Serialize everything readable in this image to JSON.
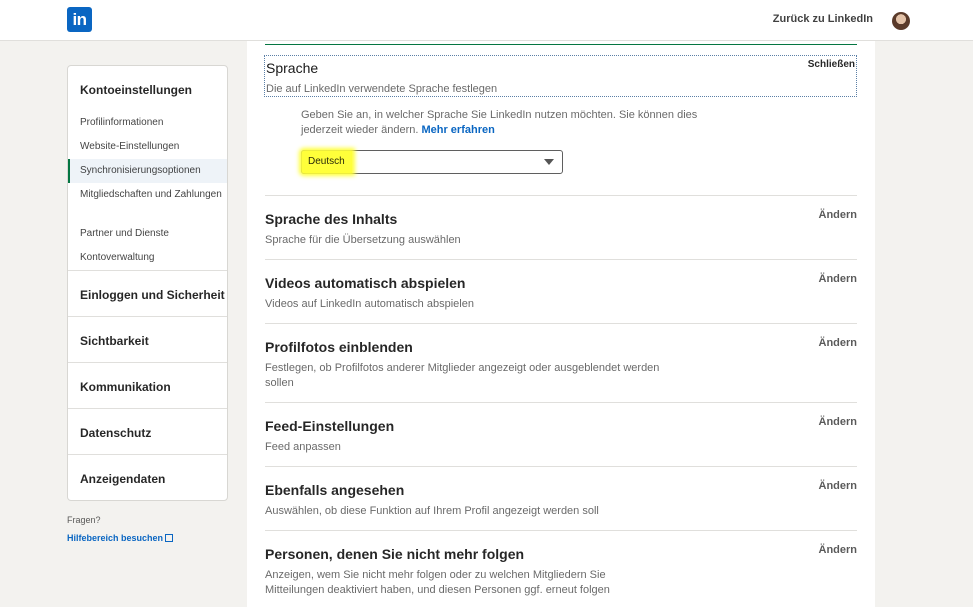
{
  "header": {
    "logo_text": "in",
    "back_link": "Zurück zu LinkedIn"
  },
  "sidebar": {
    "heading": "Kontoeinstellungen",
    "subitems": [
      {
        "label": "Profilinformationen"
      },
      {
        "label": "Website-Einstellungen"
      },
      {
        "label": "Synchronisierungsoptionen",
        "active": true
      },
      {
        "label": "Mitgliedschaften und Zahlungen"
      },
      {
        "label": "Partner und Dienste"
      },
      {
        "label": "Kontoverwaltung"
      }
    ],
    "categories": [
      {
        "label": "Einloggen und Sicherheit"
      },
      {
        "label": "Sichtbarkeit"
      },
      {
        "label": "Kommunikation"
      },
      {
        "label": "Datenschutz"
      },
      {
        "label": "Anzeigendaten"
      }
    ],
    "help_question": "Fragen?",
    "help_link": "Hilfebereich besuchen"
  },
  "main": {
    "language": {
      "title": "Sprache",
      "subtitle": "Die auf LinkedIn verwendete Sprache festlegen",
      "close_label": "Schließen",
      "info_text": "Geben Sie an, in welcher Sprache Sie LinkedIn nutzen möchten. Sie können dies jederzeit wieder ändern.",
      "learn_more": "Mehr erfahren",
      "selected_language": "Deutsch"
    },
    "change_label": "Ändern",
    "settings": [
      {
        "title": "Sprache des Inhalts",
        "description": "Sprache für die Übersetzung auswählen"
      },
      {
        "title": "Videos automatisch abspielen",
        "description": "Videos auf LinkedIn automatisch abspielen"
      },
      {
        "title": "Profilfotos einblenden",
        "description": "Festlegen, ob Profilfotos anderer Mitglieder angezeigt oder ausgeblendet werden sollen"
      },
      {
        "title": "Feed-Einstellungen",
        "description": "Feed anpassen"
      },
      {
        "title": "Ebenfalls angesehen",
        "description": "Auswählen, ob diese Funktion auf Ihrem Profil angezeigt werden soll"
      },
      {
        "title": "Personen, denen Sie nicht mehr folgen",
        "description": "Anzeigen, wem Sie nicht mehr folgen oder zu welchen Mitgliedern Sie Mitteilungen deaktiviert haben, und diesen Personen ggf. erneut folgen"
      }
    ]
  },
  "colors": {
    "brand": "#0a66c2",
    "active_indicator": "#057642",
    "highlight": "#ffff3a"
  },
  "icons": [
    "linkedin-logo",
    "avatar",
    "external-link-icon",
    "chevron-down-icon"
  ]
}
